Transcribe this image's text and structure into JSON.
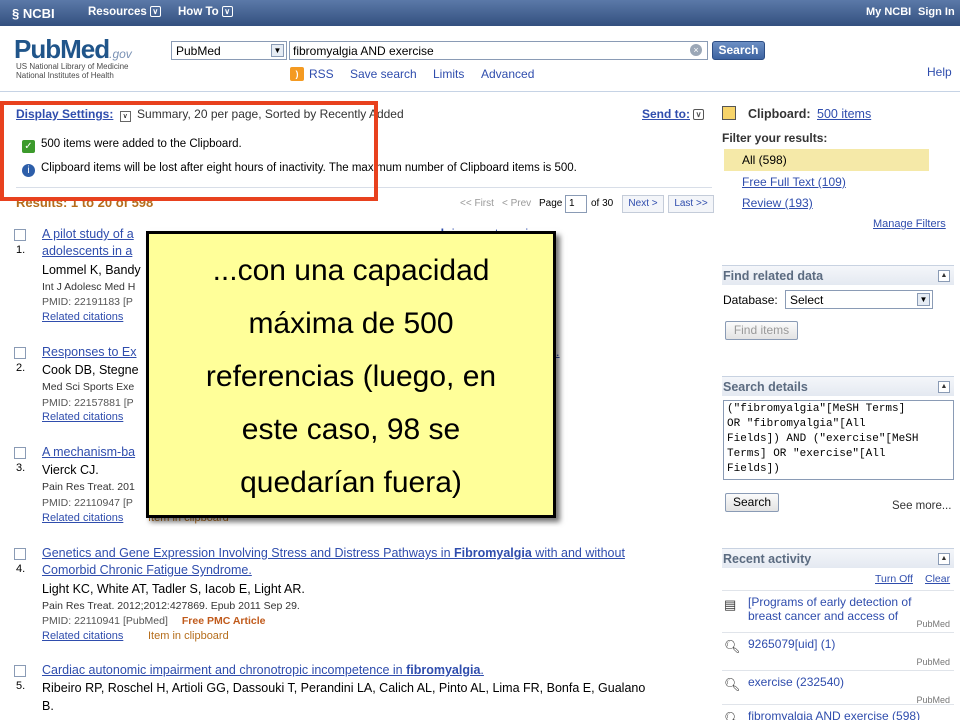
{
  "topbar": {
    "ncbi": "NCBI",
    "resources": "Resources",
    "howto": "How To",
    "my_ncbi": "My NCBI",
    "sign_in": "Sign In"
  },
  "header": {
    "logo_pub": "PubMed",
    "logo_gov": ".gov",
    "logo_sub1": "US National Library of Medicine",
    "logo_sub2": "National Institutes of Health",
    "db_value": "PubMed",
    "query": "fibromyalgia AND exercise",
    "search_label": "Search",
    "links": [
      "RSS",
      "Save search",
      "Limits",
      "Advanced"
    ],
    "help": "Help"
  },
  "main": {
    "display_settings_label": "Display Settings:",
    "display_settings_value": "Summary, 20 per page, Sorted by Recently Added",
    "send_to": "Send to:",
    "msg_added": "500 items were added to the Clipboard.",
    "msg_info": "Clipboard items will be lost after eight hours of inactivity. The maximum number of Clipboard items is 500.",
    "results_count": "Results: 1 to 20 of 598",
    "pager": {
      "first": "<< First",
      "prev": "< Prev",
      "page_label": "Page",
      "page": "1",
      "of": "of 30",
      "next": "Next >",
      "last": "Last >>"
    }
  },
  "results": [
    {
      "num": "1.",
      "title_start": "A pilot study of a",
      "title_end_bold": "alg",
      "title_end": "ia symptoms in",
      "title2": "adolescents in a",
      "authors": "Lommel K, Bandy",
      "journal": "Int J Adolesc Med H",
      "pmid": "PMID: 22191183 [P",
      "related": "Related citations"
    },
    {
      "num": "2.",
      "title_start": "Responses to Ex",
      "title_end_bold": "lgia",
      "title_end": ".",
      "authors": "Cook DB, Stegne",
      "journal": "Med Sci Sports Exe",
      "pmid": "PMID: 22157881 [P",
      "related": "Related citations"
    },
    {
      "num": "3.",
      "title_start": "A mechanism-ba",
      "authors": "Vierck CJ.",
      "journal": "Pain Res Treat. 201",
      "pmid": "PMID: 22110947 [P",
      "related": "Related citations",
      "clip": "Item in clipboard"
    },
    {
      "num": "4.",
      "title_start": "Genetics and Gene Expression Involving Stress and Distress Pathways in ",
      "title_bold": "Fibromyalgia",
      "title_end": " with and without",
      "title2": "Comorbid Chronic Fatigue Syndrome.",
      "authors": "Light KC, White AT, Tadler S, Iacob E, Light AR.",
      "journal": "Pain Res Treat. 2012;2012:427869. Epub 2011 Sep 29.",
      "pmid": "PMID: 22110941 [PubMed]",
      "pmc": "Free PMC Article",
      "related": "Related citations",
      "clip": "Item in clipboard"
    },
    {
      "num": "5.",
      "title_start": "Cardiac autonomic impairment and chronotropic incompetence in ",
      "title_bold": "fibromyalgia",
      "title_end": ".",
      "authors": "Ribeiro RP, Roschel H, Artioli GG, Dassouki T, Perandini LA, Calich AL, Pinto AL, Lima FR, Bonfa E, Gualano",
      "authors2": "B."
    }
  ],
  "sidebar": {
    "clipboard_label": "Clipboard:",
    "clipboard_link": "500 items",
    "filter_title": "Filter your results:",
    "filters": [
      "All (598)",
      "Free Full Text (109)",
      "Review (193)"
    ],
    "manage_filters": "Manage Filters",
    "related_title": "Find related data",
    "database_label": "Database:",
    "database_value": "Select",
    "find_items": "Find items",
    "details_title": "Search details",
    "details_text": "(\"fibromyalgia\"[MeSH Terms]\nOR \"fibromyalgia\"[All\nFields]) AND (\"exercise\"[MeSH\nTerms] OR \"exercise\"[All\nFields])",
    "details_search": "Search",
    "see_more": "See more...",
    "recent_title": "Recent activity",
    "turn_off": "Turn Off",
    "clear": "Clear",
    "recent": [
      {
        "icon": "document-icon",
        "text": "[Programs of early detection of breast cancer and access of",
        "src": "PubMed"
      },
      {
        "icon": "magnifier-icon",
        "text": "9265079[uid] (1)",
        "src": "PubMed"
      },
      {
        "icon": "magnifier-icon",
        "text": "exercise (232540)",
        "src": "PubMed"
      },
      {
        "icon": "magnifier-icon",
        "text": "fibromyalgia AND exercise (598)",
        "src": ""
      }
    ]
  },
  "note": {
    "lines": [
      "...con una capacidad",
      "máxima de 500",
      "referencias (luego, en",
      "este caso, 98 se",
      "quedarían fuera)"
    ]
  },
  "colors": {
    "topbar": "#33507f",
    "link": "#2f4dad",
    "frame": "#e8411e",
    "note_bg": "#ffff99",
    "results_count": "#b56d1b"
  }
}
